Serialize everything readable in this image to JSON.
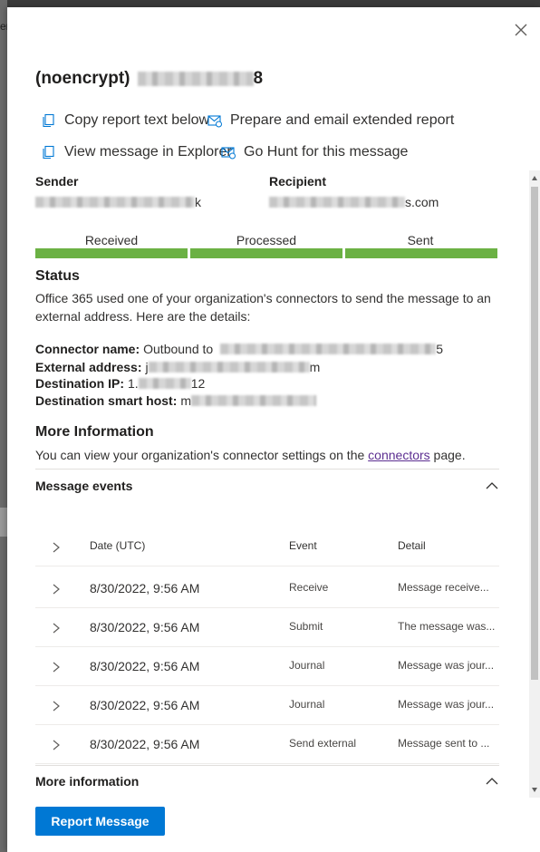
{
  "background": {
    "edge_letter": "er"
  },
  "panel": {
    "title_prefix": "(noencrypt)",
    "title_suffix": "8",
    "close_icon": "close-icon"
  },
  "actions": {
    "copy_report": "Copy report text below",
    "prepare_email": "Prepare and email extended report",
    "view_explorer": "View message in Explorer",
    "go_hunt": "Go Hunt for this message"
  },
  "sender": {
    "label": "Sender",
    "value_suffix": "k"
  },
  "recipient": {
    "label": "Recipient",
    "value_suffix": "s.com"
  },
  "progress": {
    "steps": [
      "Received",
      "Processed",
      "Sent"
    ],
    "color": "#6bb144"
  },
  "status": {
    "heading": "Status",
    "text": "Office 365 used one of your organization's connectors to send the message to an external address. Here are the details:",
    "connector_name_label": "Connector name:",
    "connector_name_value": "Outbound to",
    "connector_name_suffix": "5",
    "external_address_label": "External address:",
    "external_address_prefix": "j",
    "external_address_suffix": "m",
    "destination_ip_label": "Destination IP:",
    "destination_ip_prefix": "1.",
    "destination_ip_suffix": "12",
    "smart_host_label": "Destination smart host:",
    "smart_host_prefix": "m"
  },
  "more_info": {
    "heading": "More Information",
    "text_before": "You can view your organization's connector settings on the",
    "link": "connectors",
    "text_after": "page."
  },
  "message_events": {
    "heading": "Message events",
    "columns": [
      "Date (UTC)",
      "Event",
      "Detail"
    ],
    "rows": [
      {
        "date": "8/30/2022, 9:56 AM",
        "event": "Receive",
        "detail": "Message receive..."
      },
      {
        "date": "8/30/2022, 9:56 AM",
        "event": "Submit",
        "detail": "The message was..."
      },
      {
        "date": "8/30/2022, 9:56 AM",
        "event": "Journal",
        "detail": "Message was jour..."
      },
      {
        "date": "8/30/2022, 9:56 AM",
        "event": "Journal",
        "detail": "Message was jour..."
      },
      {
        "date": "8/30/2022, 9:56 AM",
        "event": "Send external",
        "detail": "Message sent to ..."
      }
    ]
  },
  "more_information_section": {
    "heading": "More information"
  },
  "footer": {
    "report_button": "Report Message",
    "accent": "#0078d4"
  }
}
